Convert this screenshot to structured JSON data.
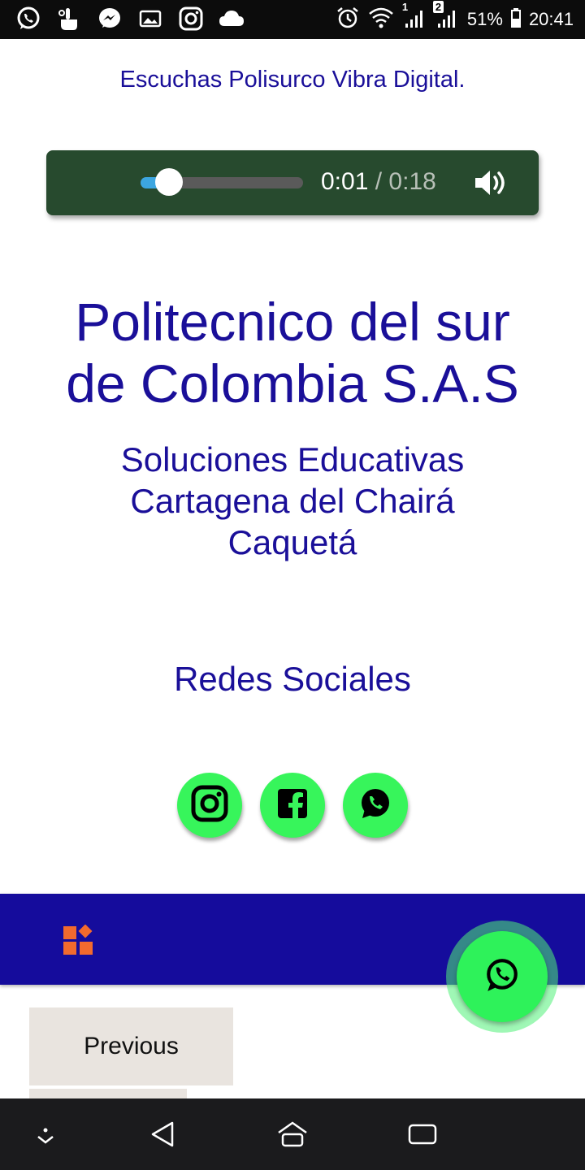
{
  "status_bar": {
    "battery_percent": "51%",
    "time": "20:41",
    "sim1_label": "1",
    "sim2_label": "2",
    "left_icons": [
      "whatsapp-icon",
      "touch-icon",
      "messenger-icon",
      "gallery-icon",
      "instagram-icon",
      "cloud-icon"
    ],
    "right_icons": [
      "alarm-icon",
      "wifi-icon",
      "signal-icon",
      "signal-icon",
      "battery-icon"
    ]
  },
  "page": {
    "caption": "Escuchas Polisurco Vibra Digital.",
    "title_line1": "Politecnico del sur",
    "title_line2": "de Colombia S.A.S",
    "subtitle_line1": "Soluciones Educativas",
    "subtitle_line2": "Cartagena del Chairá",
    "subtitle_line3": "Caquetá",
    "social_heading": "Redes Sociales"
  },
  "audio": {
    "current_time": "0:01",
    "separator": "/",
    "total_time": "0:18",
    "progress": 0.06,
    "colors": {
      "background": "#274a2e",
      "fill": "#3ca6e0"
    }
  },
  "social_links": [
    "instagram-icon",
    "facebook-icon",
    "whatsapp-icon"
  ],
  "pagination": {
    "previous_label": "Previous"
  },
  "colors": {
    "primary": "#1a0f99",
    "band": "#150c9c",
    "social_green": "#37f55b",
    "apps_orange": "#f26a2e"
  },
  "nav_bar": {
    "buttons": [
      "hide-keyboard-icon",
      "back-icon",
      "home-icon",
      "recents-icon"
    ]
  }
}
